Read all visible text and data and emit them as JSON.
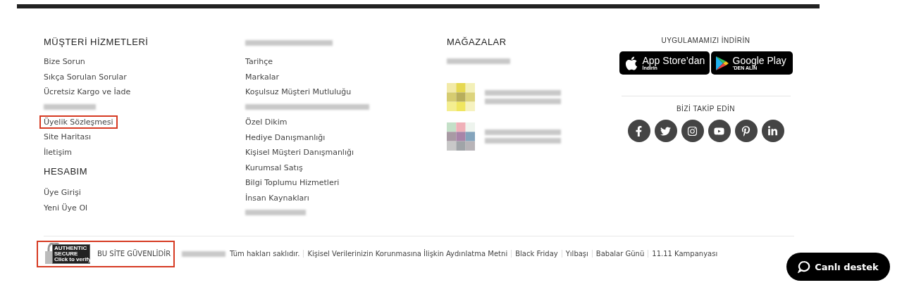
{
  "columns": [
    {
      "heading": "MÜŞTERİ HİZMETLERİ",
      "items": [
        {
          "kind": "link",
          "label": "Bize Sorun",
          "highlighted": false
        },
        {
          "kind": "link",
          "label": "Sıkça Sorulan Sorular",
          "highlighted": false
        },
        {
          "kind": "link",
          "label": "Ücretsiz Kargo ve İade",
          "highlighted": false
        },
        {
          "kind": "redacted"
        },
        {
          "kind": "link",
          "label": "Üyelik Sözleşmesi",
          "highlighted": true
        },
        {
          "kind": "link",
          "label": "Site Haritası",
          "highlighted": false
        },
        {
          "kind": "link",
          "label": "İletişim",
          "highlighted": false
        },
        {
          "kind": "heading",
          "label": "HESABIM"
        },
        {
          "kind": "link",
          "label": "Üye Girişi",
          "highlighted": false
        },
        {
          "kind": "link",
          "label": "Yeni Üye Ol",
          "highlighted": false
        }
      ]
    },
    {
      "items": [
        {
          "kind": "redacted_heading"
        },
        {
          "kind": "link",
          "label": "Tarihçe",
          "highlighted": false
        },
        {
          "kind": "link",
          "label": "Markalar",
          "highlighted": false
        },
        {
          "kind": "link",
          "label": "Koşulsuz Müşteri Mutluluğu",
          "highlighted": false
        },
        {
          "kind": "redacted"
        },
        {
          "kind": "link",
          "label": "Özel Dikim",
          "highlighted": false
        },
        {
          "kind": "link",
          "label": "Hediye Danışmanlığı",
          "highlighted": false
        },
        {
          "kind": "link",
          "label": "Kişisel Müşteri Danışmanlığı",
          "highlighted": false
        },
        {
          "kind": "link",
          "label": "Kurumsal Satış",
          "highlighted": false
        },
        {
          "kind": "link",
          "label": "Bilgi Toplumu Hizmetleri",
          "highlighted": false
        },
        {
          "kind": "link",
          "label": "İnsan Kaynakları",
          "highlighted": false
        },
        {
          "kind": "redacted"
        }
      ]
    }
  ],
  "stores": {
    "heading": "MAĞAZALAR",
    "entries": [
      {
        "kind": "yellow"
      },
      {
        "kind": "mixed"
      }
    ]
  },
  "apps": {
    "heading": "UYGULAMAMIZI İNDİRİN",
    "buttons": [
      {
        "kind": "apple",
        "title": "App Store’dan",
        "subtitle": "İndirin"
      },
      {
        "kind": "google",
        "title": "Google Play",
        "subtitle": "’DEN ALIN"
      }
    ]
  },
  "social": {
    "heading": "BİZİ TAKİP EDİN",
    "icons": [
      {
        "kind": "facebook"
      },
      {
        "kind": "twitter"
      },
      {
        "kind": "instagram"
      },
      {
        "kind": "youtube"
      },
      {
        "kind": "pinterest"
      },
      {
        "kind": "linkedin"
      }
    ]
  },
  "footer": {
    "badge": {
      "seal_lines": [
        "AUTHENTIC",
        "SECURE",
        "Click to verify"
      ],
      "label": "BU SİTE GÜVENLİDİR",
      "highlighted": true
    },
    "copyright": "Tüm hakları saklıdır.",
    "links": [
      "Kişisel Verilerinizin Korunmasına İlişkin Aydınlatma Metni",
      "Black Friday",
      "Yılbaşı",
      "Babalar Günü",
      "11.11 Kampanyası"
    ]
  },
  "chat_button": {
    "label": "Canlı destek"
  }
}
